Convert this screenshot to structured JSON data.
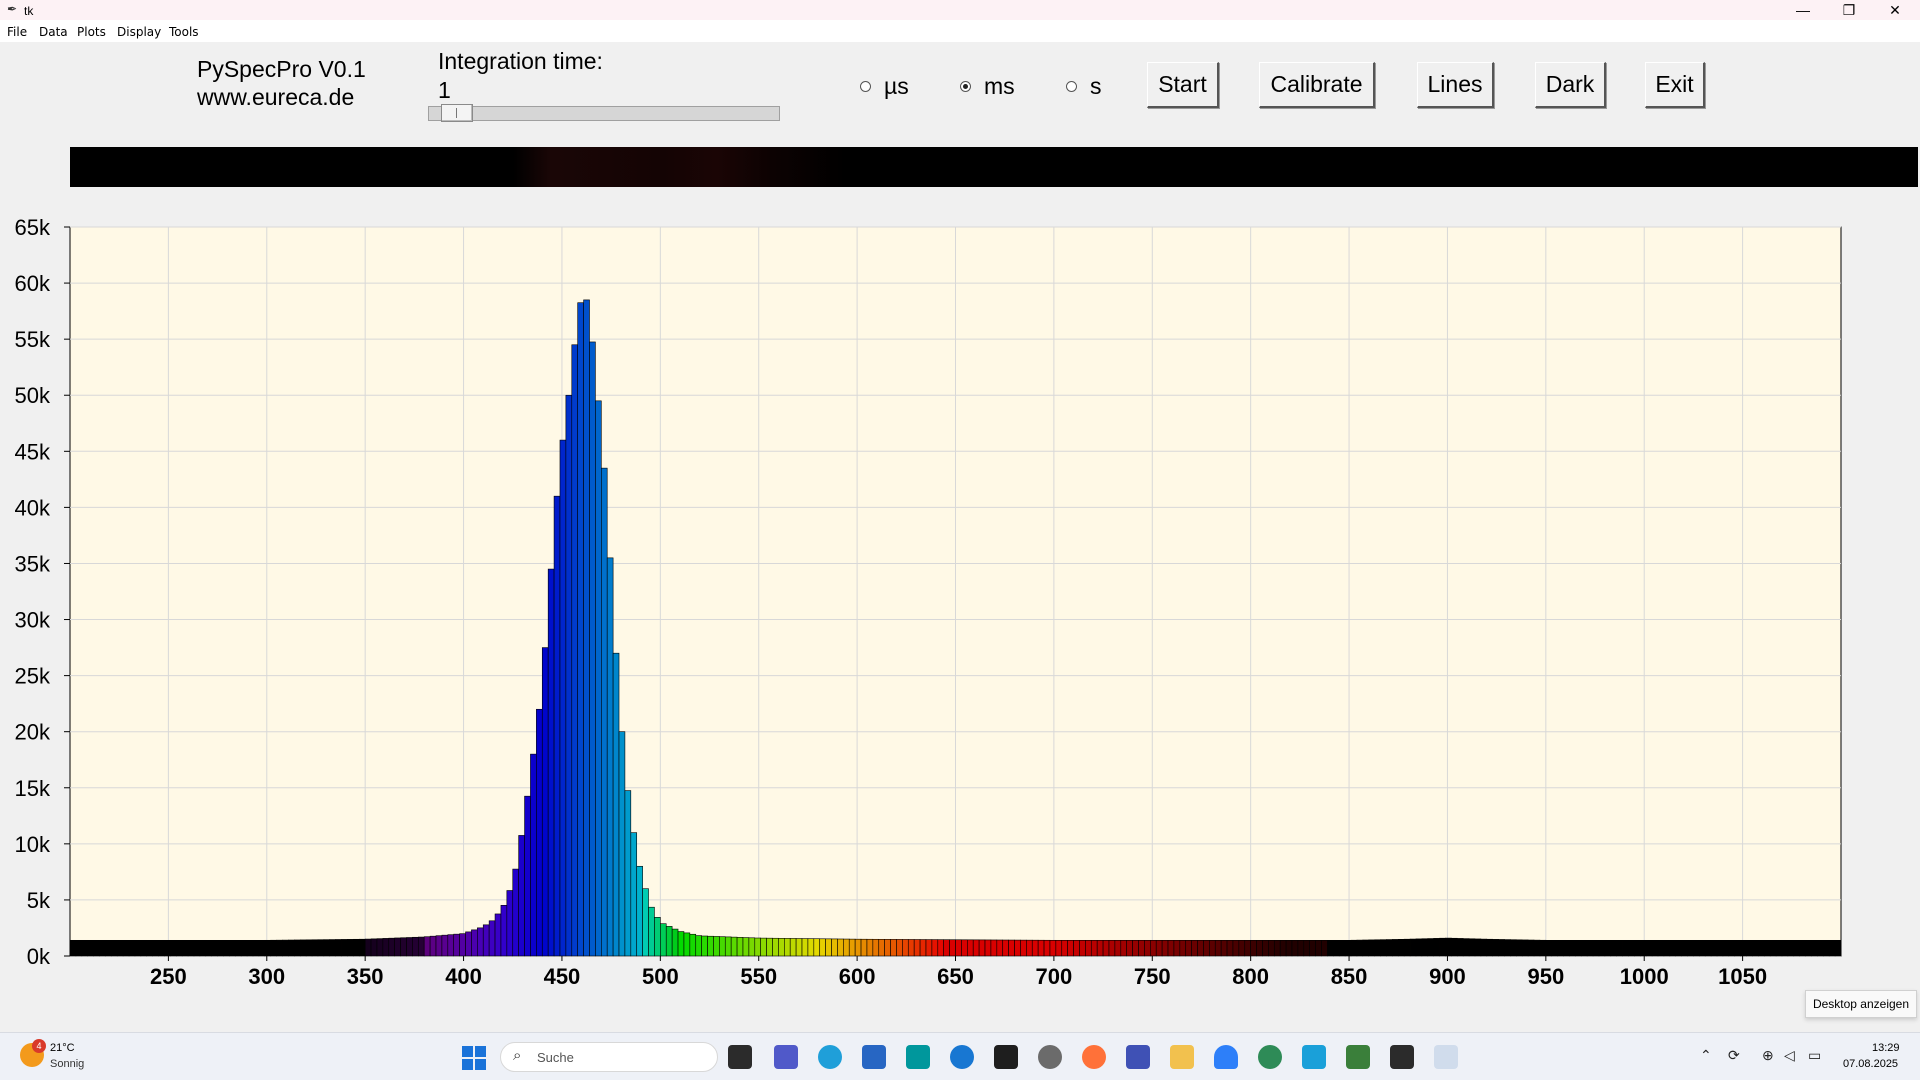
{
  "window": {
    "title": "tk",
    "minimize_glyph": "—",
    "maximize_glyph": "❐",
    "close_glyph": "✕"
  },
  "menu": {
    "items": [
      "File",
      "Data",
      "Plots",
      "Display",
      "Tools"
    ]
  },
  "header": {
    "app_name": "PySpecPro V0.1",
    "website": "www.eureca.de",
    "integration_label": "Integration time:",
    "integration_value": "1",
    "integration_slider_fraction": 0.04
  },
  "units": [
    {
      "label": "µs",
      "selected": false
    },
    {
      "label": "ms",
      "selected": true
    },
    {
      "label": "s",
      "selected": false
    }
  ],
  "buttons": {
    "start": "Start",
    "calibrate": "Calibrate",
    "lines": "Lines",
    "dark": "Dark",
    "exit": "Exit"
  },
  "chart_data": {
    "type": "bar",
    "title": "",
    "xlabel": "",
    "ylabel": "",
    "xlim": [
      200,
      1100
    ],
    "ylim": [
      0,
      65000
    ],
    "xticks": [
      250,
      300,
      350,
      400,
      450,
      500,
      550,
      600,
      650,
      700,
      750,
      800,
      850,
      900,
      950,
      1000,
      1050
    ],
    "yticks": [
      0,
      5000,
      10000,
      15000,
      20000,
      25000,
      30000,
      35000,
      40000,
      45000,
      50000,
      55000,
      60000,
      65000
    ],
    "ytick_labels": [
      "0k",
      "5k",
      "10k",
      "15k",
      "20k",
      "25k",
      "30k",
      "35k",
      "40k",
      "45k",
      "50k",
      "55k",
      "60k",
      "65k"
    ],
    "grid": true,
    "background": "#fff9e6",
    "bar_coloring": "wavelength (visible spectrum), black outside ~350–840 nm",
    "series": [
      {
        "x": [
          200,
          300,
          350,
          380,
          400,
          410,
          415,
          420,
          425,
          428,
          431,
          434,
          437,
          440,
          443,
          446,
          449,
          452,
          455,
          458,
          461,
          464,
          467,
          470,
          473,
          476,
          479,
          482,
          485,
          490,
          495,
          500,
          510,
          520,
          550,
          600,
          700,
          800,
          850,
          880,
          900,
          920,
          950,
          1000,
          1100
        ],
        "values": [
          1400,
          1400,
          1500,
          1700,
          2000,
          2600,
          3200,
          4300,
          6500,
          9000,
          12500,
          16000,
          20000,
          24000,
          31000,
          38000,
          44000,
          48000,
          52000,
          57000,
          59500,
          57500,
          52000,
          47000,
          40000,
          31000,
          23000,
          17000,
          12500,
          7500,
          4500,
          3000,
          2200,
          1800,
          1600,
          1500,
          1400,
          1400,
          1400,
          1500,
          1600,
          1500,
          1400,
          1400,
          1400
        ]
      }
    ]
  },
  "tooltip": "Desktop anzeigen",
  "taskbar": {
    "weather_badge": "4",
    "temperature": "21°C",
    "condition": "Sonnig",
    "search_placeholder": "Suche",
    "search_glyph": "⌕",
    "time": "13:29",
    "date": "07.08.2025"
  }
}
